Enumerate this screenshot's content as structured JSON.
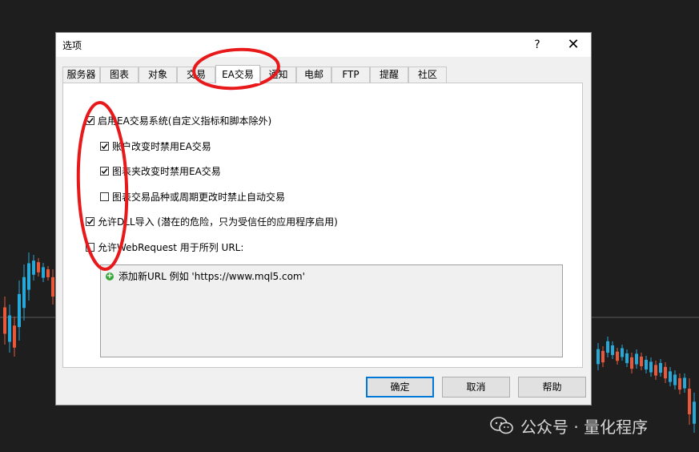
{
  "dialog": {
    "title": "选项",
    "help_glyph": "?",
    "close_glyph": "✕",
    "tabs": [
      {
        "label": "服务器"
      },
      {
        "label": "图表"
      },
      {
        "label": "对象"
      },
      {
        "label": "交易"
      },
      {
        "label": "EA交易",
        "active": true
      },
      {
        "label": "通知"
      },
      {
        "label": "电邮"
      },
      {
        "label": "FTP"
      },
      {
        "label": "提醒"
      },
      {
        "label": "社区"
      }
    ],
    "options": {
      "enable_ea": {
        "label": "启用EA交易系统(自定义指标和脚本除外)",
        "checked": true
      },
      "disable_on_account_change": {
        "label": "账户改变时禁用EA交易",
        "checked": true
      },
      "disable_on_profile_change": {
        "label": "图表夹改变时禁用EA交易",
        "checked": true
      },
      "disable_on_symbol_change": {
        "label": "图表交易品种或周期更改时禁止自动交易",
        "checked": false
      },
      "allow_dll": {
        "label": "允许DLL导入 (潜在的危险，只为受信任的应用程序启用)",
        "checked": true
      },
      "allow_webrequest": {
        "label": "允许WebRequest 用于所列 URL:",
        "checked": false
      }
    },
    "url_list": {
      "add_item": "添加新URL 例如 'https://www.mql5.com'"
    },
    "buttons": {
      "ok": "确定",
      "cancel": "取消",
      "help": "帮助"
    }
  },
  "watermark": {
    "text": "公众号 · 量化程序"
  },
  "colors": {
    "bull": "#26a8d8",
    "bear": "#e8583a",
    "annotation": "#e8191a",
    "default_button_border": "#0078d7"
  }
}
